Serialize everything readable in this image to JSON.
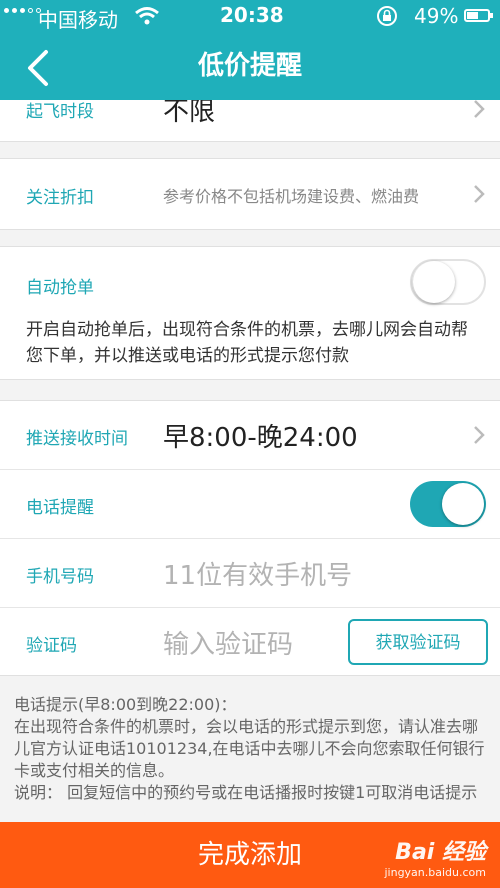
{
  "status": {
    "carrier": "中国移动",
    "time": "20:38",
    "battery": "49%",
    "battery_level": 0.49
  },
  "header": {
    "title": "低价提醒"
  },
  "rows": {
    "takeoff": {
      "label": "起飞时段",
      "value": "不限"
    },
    "discount": {
      "label": "关注折扣",
      "value": "参考价格不包括机场建设费、燃油费"
    },
    "auto_grab": {
      "label": "自动抢单",
      "toggle": false,
      "note": "开启自动抢单后，出现符合条件的机票，去哪儿网会自动帮您下单，并以推送或电话的形式提示您付款"
    },
    "push_time": {
      "label": "推送接收时间",
      "value": "早8:00-晚24:00"
    },
    "phone_alert": {
      "label": "电话提醒",
      "toggle": true
    },
    "phone": {
      "label": "手机号码",
      "placeholder": "11位有效手机号"
    },
    "code": {
      "label": "验证码",
      "placeholder": "输入验证码",
      "button": "获取验证码"
    }
  },
  "tips": [
    "电话提示(早8:00到晚22:00)：",
    "在出现符合条件的机票时，会以电话的形式提示到您，请认准去哪儿官方认证电话10101234,在电话中去哪儿不会向您索取任何银行卡或支付相关的信息。",
    "说明： 回复短信中的预约号或在电话播报时按键1可取消电话提示"
  ],
  "footer": {
    "button": "完成添加"
  },
  "watermark": {
    "logo": "Bai 经验",
    "url": "jingyan.baidu.com"
  },
  "colors": {
    "primary": "#1fb0bb",
    "label": "#1fa7b4",
    "cta": "#ff5a11"
  }
}
